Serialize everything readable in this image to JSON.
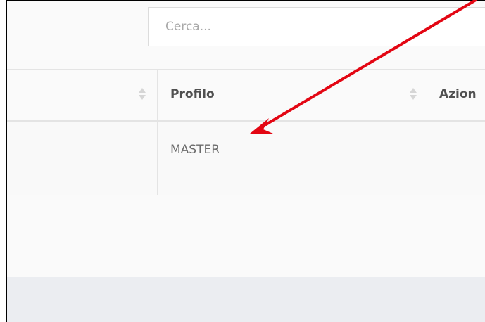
{
  "search": {
    "placeholder": "Cerca..."
  },
  "table": {
    "headers": [
      "",
      "Profilo",
      "Azion"
    ],
    "rows": [
      [
        "",
        "MASTER",
        ""
      ]
    ]
  },
  "annotation": {
    "arrow_color": "#e30613"
  }
}
